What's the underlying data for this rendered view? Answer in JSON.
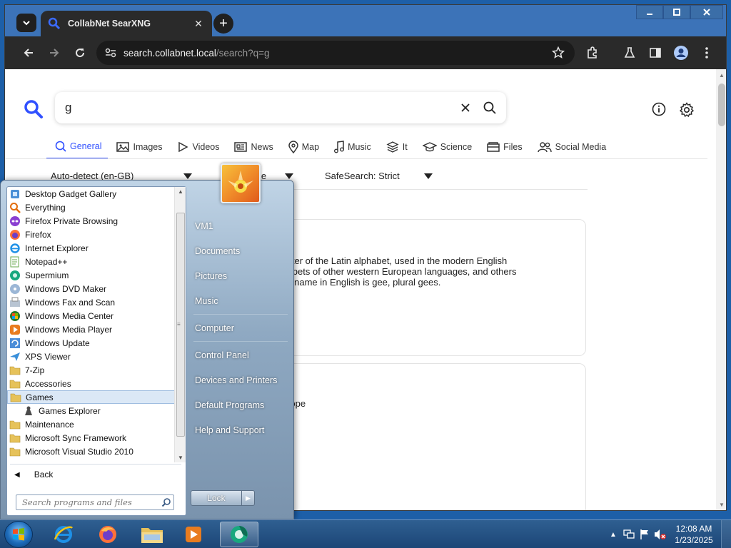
{
  "browser": {
    "tab_title": "CollabNet SearXNG",
    "url_host": "search.collabnet.local",
    "url_path": "/search?q=g"
  },
  "search": {
    "query": "g",
    "categories": [
      {
        "label": "General",
        "icon": "search-icon",
        "active": true
      },
      {
        "label": "Images",
        "icon": "image-icon",
        "active": false
      },
      {
        "label": "Videos",
        "icon": "play-icon",
        "active": false
      },
      {
        "label": "News",
        "icon": "newspaper-icon",
        "active": false
      },
      {
        "label": "Map",
        "icon": "map-pin-icon",
        "active": false
      },
      {
        "label": "Music",
        "icon": "music-icon",
        "active": false
      },
      {
        "label": "It",
        "icon": "layers-icon",
        "active": false
      },
      {
        "label": "Science",
        "icon": "science-icon",
        "active": false
      },
      {
        "label": "Files",
        "icon": "files-icon",
        "active": false
      },
      {
        "label": "Social Media",
        "icon": "people-icon",
        "active": false
      }
    ],
    "filters": {
      "language": "Auto-detect (en-GB)",
      "time_partial": "me",
      "safesearch": "SafeSearch: Strict"
    }
  },
  "results": {
    "card1_line1": "seventh letter of the Latin alphabet, used in the modern English",
    "card1_line2": "alphabets of other western European languages, and others",
    "card1_line3": "s name in English is gee, plural gees.",
    "card2_line1": "entral Europe"
  },
  "start_menu": {
    "programs": [
      {
        "label": "Desktop Gadget Gallery",
        "icon": "gadget-icon",
        "sub": false,
        "selected": false
      },
      {
        "label": "Everything",
        "icon": "magnifier-app-icon",
        "sub": false,
        "selected": false
      },
      {
        "label": "Firefox Private Browsing",
        "icon": "firefox-private-icon",
        "sub": false,
        "selected": false
      },
      {
        "label": "Firefox",
        "icon": "firefox-icon",
        "sub": false,
        "selected": false
      },
      {
        "label": "Internet Explorer",
        "icon": "internet-explorer-icon",
        "sub": false,
        "selected": false
      },
      {
        "label": "Notepad++",
        "icon": "notepadpp-icon",
        "sub": false,
        "selected": false
      },
      {
        "label": "Supermium",
        "icon": "supermium-icon",
        "sub": false,
        "selected": false
      },
      {
        "label": "Windows DVD Maker",
        "icon": "dvd-maker-icon",
        "sub": false,
        "selected": false
      },
      {
        "label": "Windows Fax and Scan",
        "icon": "fax-icon",
        "sub": false,
        "selected": false
      },
      {
        "label": "Windows Media Center",
        "icon": "media-center-icon",
        "sub": false,
        "selected": false
      },
      {
        "label": "Windows Media Player",
        "icon": "media-player-icon",
        "sub": false,
        "selected": false
      },
      {
        "label": "Windows Update",
        "icon": "windows-update-icon",
        "sub": false,
        "selected": false
      },
      {
        "label": "XPS Viewer",
        "icon": "xps-viewer-icon",
        "sub": false,
        "selected": false
      },
      {
        "label": "7-Zip",
        "icon": "folder-icon",
        "sub": false,
        "selected": false
      },
      {
        "label": "Accessories",
        "icon": "folder-icon",
        "sub": false,
        "selected": false
      },
      {
        "label": "Games",
        "icon": "folder-icon",
        "sub": false,
        "selected": true
      },
      {
        "label": "Games Explorer",
        "icon": "games-explorer-icon",
        "sub": true,
        "selected": false
      },
      {
        "label": "Maintenance",
        "icon": "folder-icon",
        "sub": false,
        "selected": false
      },
      {
        "label": "Microsoft Sync Framework",
        "icon": "folder-icon",
        "sub": false,
        "selected": false
      },
      {
        "label": "Microsoft Visual Studio 2010",
        "icon": "folder-icon",
        "sub": false,
        "selected": false
      }
    ],
    "back_label": "Back",
    "search_placeholder": "Search programs and files",
    "right_links": [
      "VM1",
      "Documents",
      "Pictures",
      "Music",
      "Computer",
      "Control Panel",
      "Devices and Printers",
      "Default Programs",
      "Help and Support"
    ],
    "lock_label": "Lock"
  },
  "taskbar": {
    "apps": [
      "internet-explorer-icon",
      "firefox-icon",
      "file-explorer-icon",
      "media-player-icon",
      "supermium-icon"
    ],
    "time": "12:08 AM",
    "date": "1/23/2025"
  },
  "colors": {
    "accent": "#3050ff",
    "taskbar": "#1c4677",
    "titlebar": "#3c73b8"
  }
}
